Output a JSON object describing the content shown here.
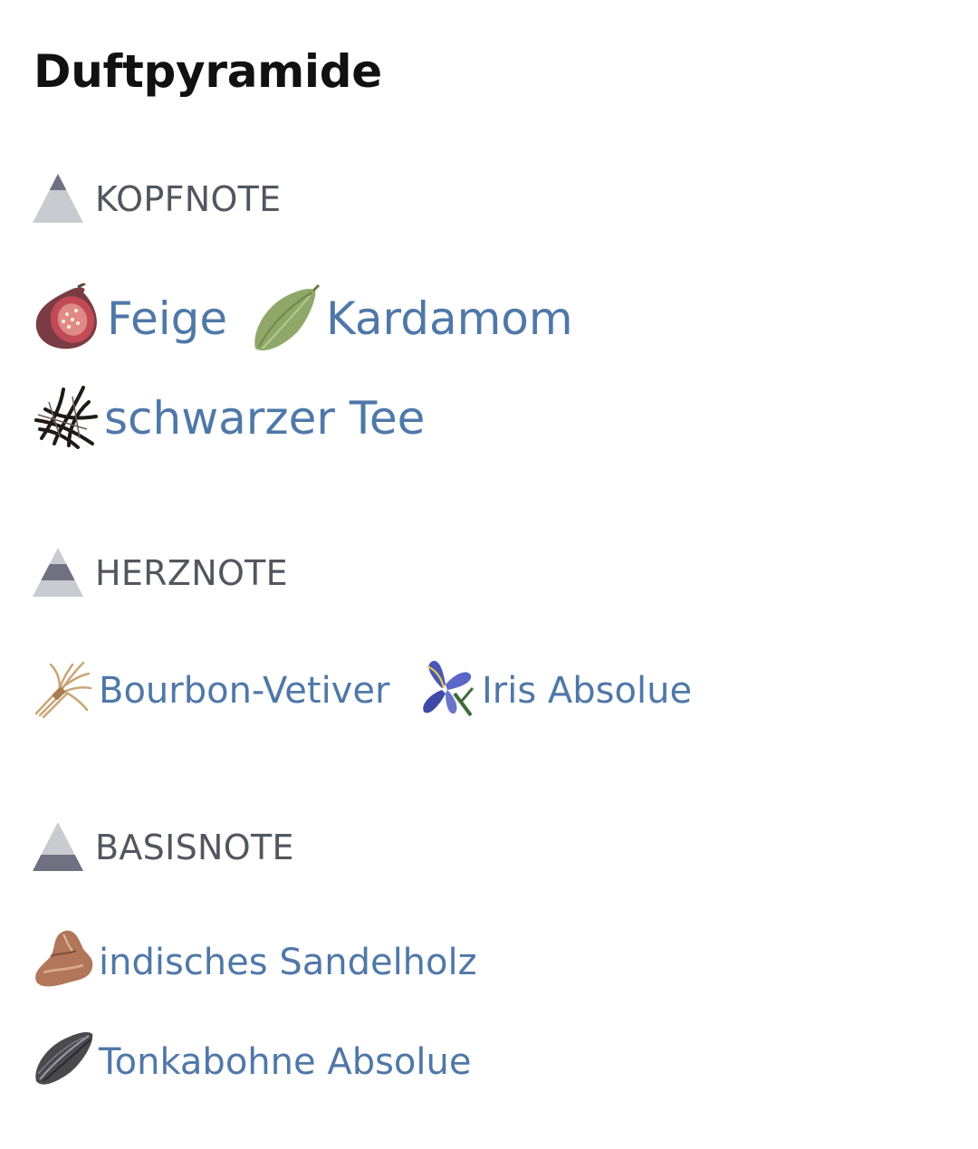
{
  "title": "Duftpyramide",
  "colors": {
    "note_link": "#4f78a8",
    "section_label": "#52575e",
    "title": "#111111",
    "pyramid_dark": "#6f7180",
    "pyramid_light": "#cacbd0"
  },
  "sections": [
    {
      "label": "KOPFNOTE",
      "icon": "pyramid-top-icon",
      "notes": [
        {
          "label": "Feige",
          "icon": "fig-icon"
        },
        {
          "label": "Kardamom",
          "icon": "cardamom-icon"
        },
        {
          "label": "schwarzer Tee",
          "icon": "black-tea-icon"
        }
      ]
    },
    {
      "label": "HERZNOTE",
      "icon": "pyramid-middle-icon",
      "notes": [
        {
          "label": "Bourbon-Vetiver",
          "icon": "vetiver-icon"
        },
        {
          "label": "Iris Absolue",
          "icon": "iris-icon"
        }
      ]
    },
    {
      "label": "BASISNOTE",
      "icon": "pyramid-base-icon",
      "notes": [
        {
          "label": "indisches Sandelholz",
          "icon": "sandalwood-icon"
        },
        {
          "label": "Tonkabohne Absolue",
          "icon": "tonka-bean-icon"
        }
      ]
    }
  ]
}
